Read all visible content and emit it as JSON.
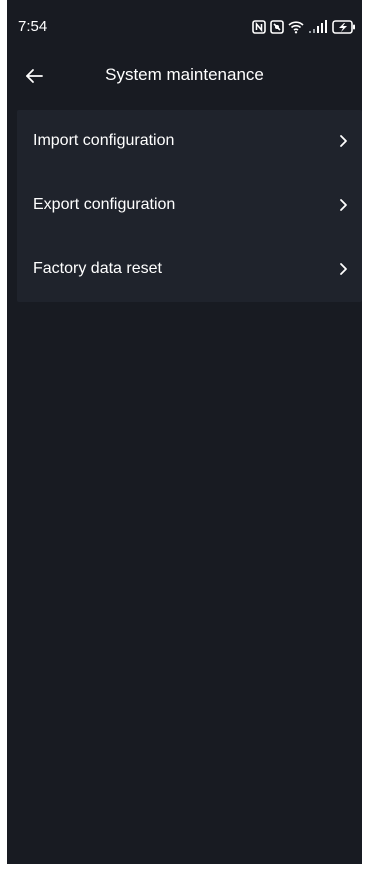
{
  "status_bar": {
    "time": "7:54",
    "icons": [
      "nfc-icon",
      "mute-icon",
      "wifi-icon",
      "signal-icon",
      "battery-icon"
    ]
  },
  "header": {
    "title": "System maintenance",
    "back_icon": "back-arrow-icon"
  },
  "menu": {
    "items": [
      {
        "label": "Import configuration",
        "icon": "chevron-right-icon"
      },
      {
        "label": "Export configuration",
        "icon": "chevron-right-icon"
      },
      {
        "label": "Factory data reset",
        "icon": "chevron-right-icon"
      }
    ]
  },
  "colors": {
    "background": "#181b22",
    "card": "#1f232c",
    "text": "#ffffff"
  }
}
